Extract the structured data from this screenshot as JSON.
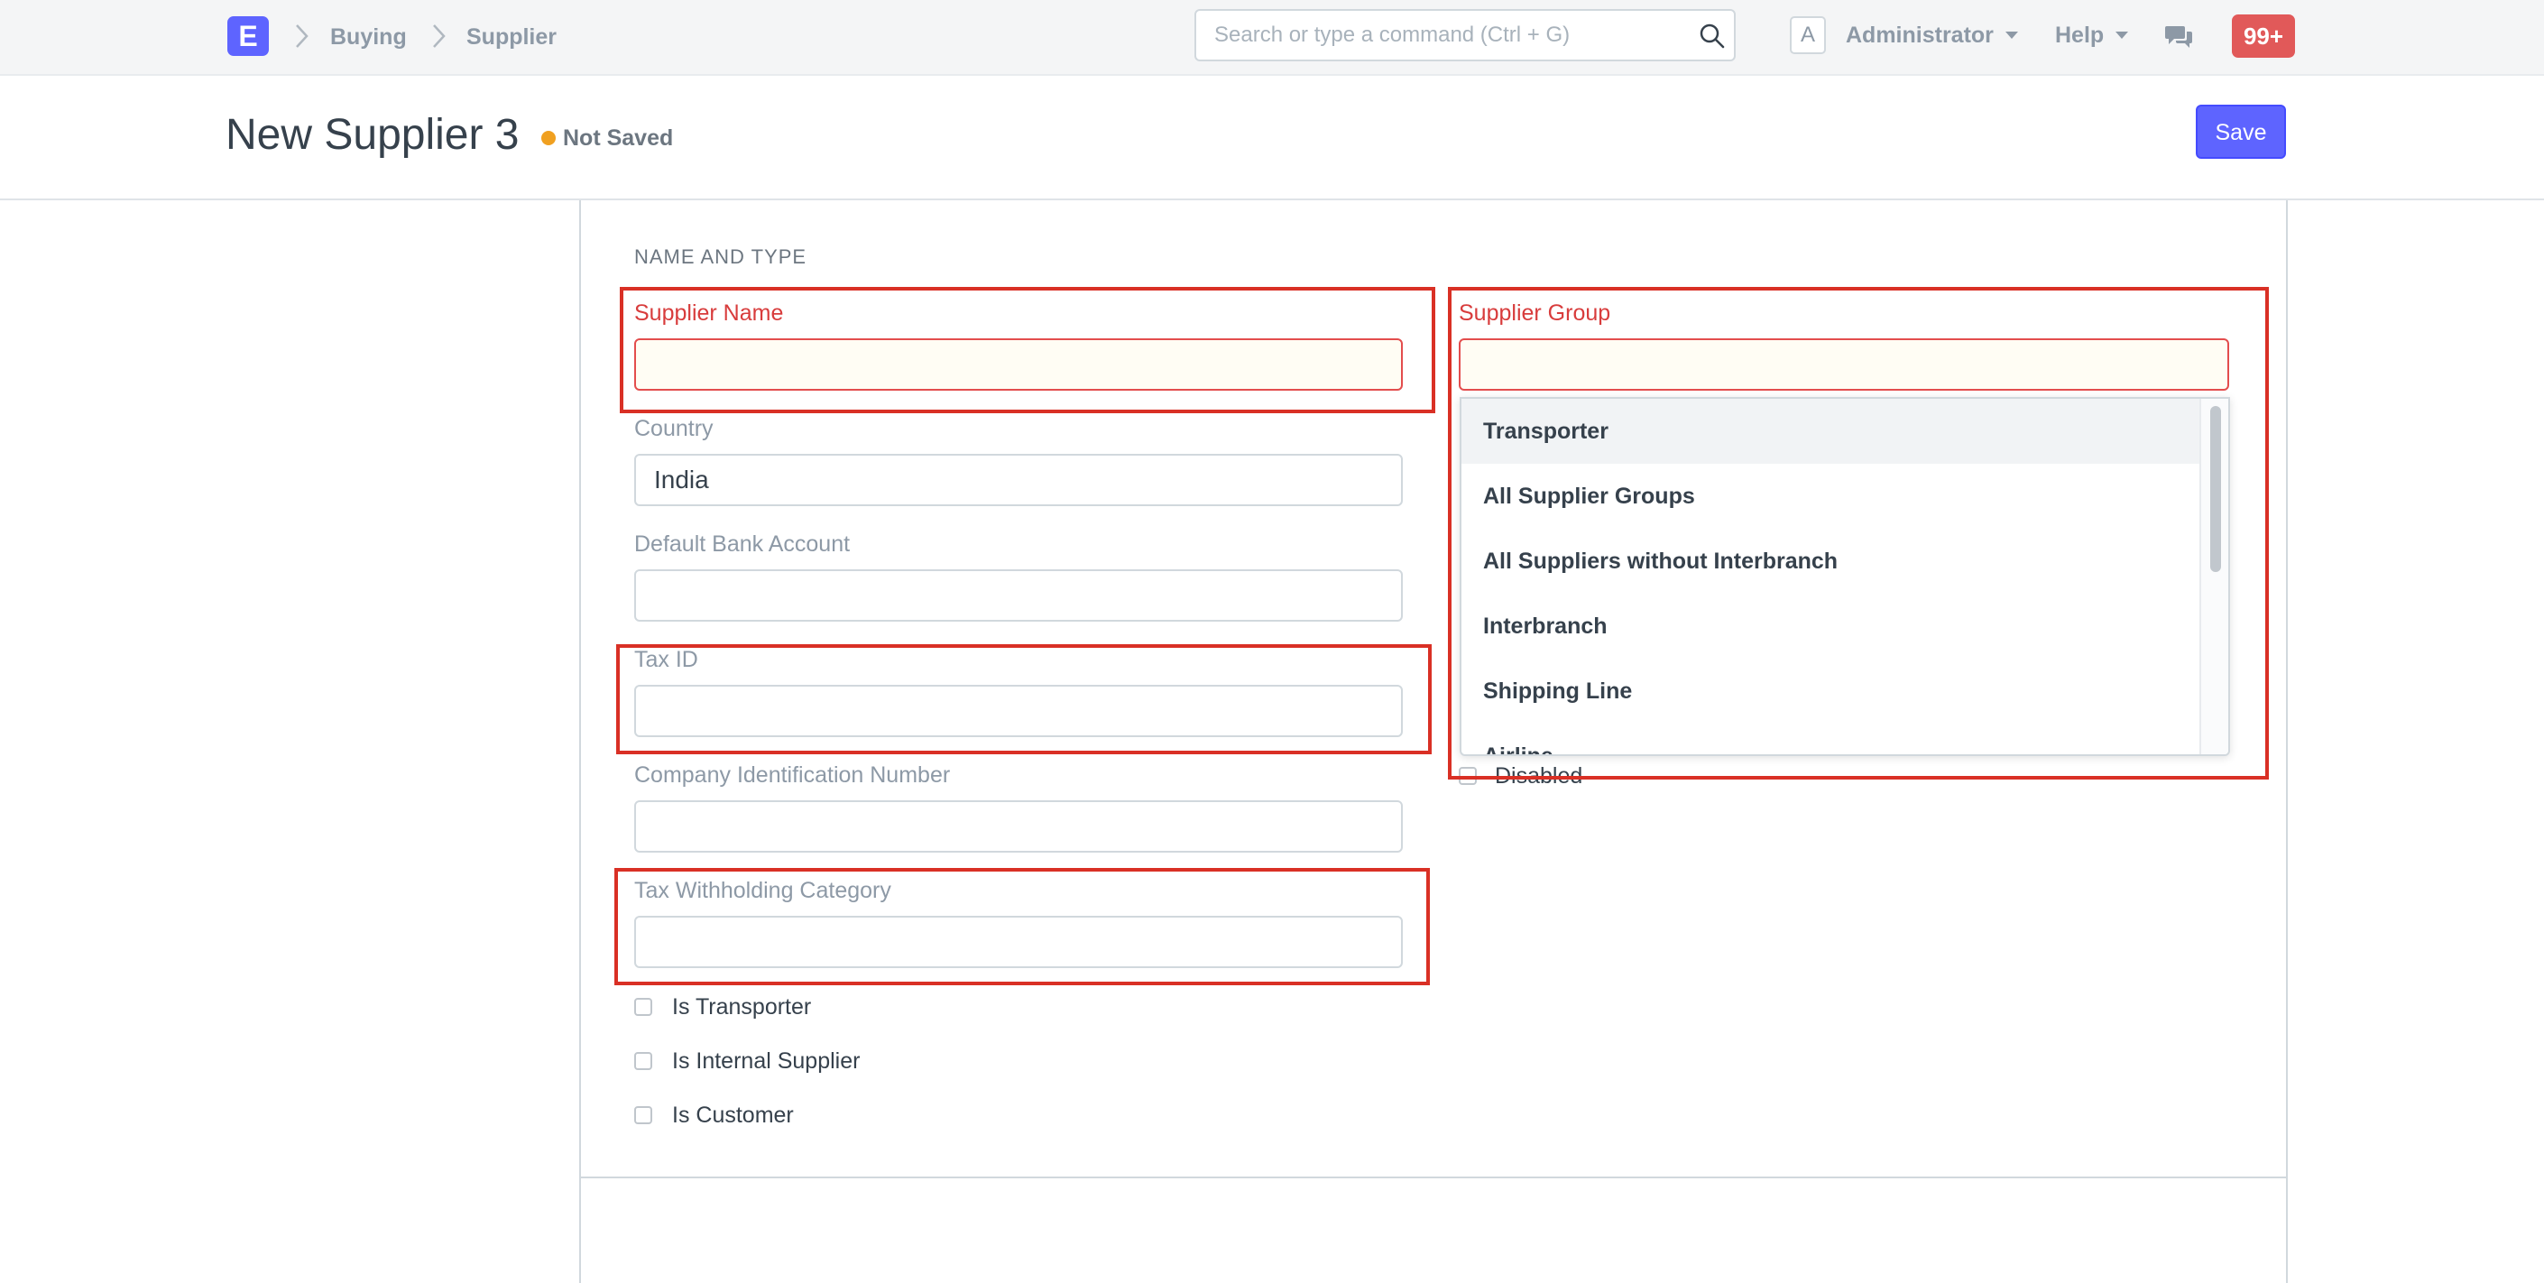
{
  "navbar": {
    "logo_letter": "E",
    "breadcrumbs": [
      "Buying",
      "Supplier"
    ],
    "search_placeholder": "Search or type a command (Ctrl + G)",
    "avatar_letter": "A",
    "user_menu": "Administrator",
    "help_menu": "Help",
    "notifications": "99+"
  },
  "page": {
    "title": "New Supplier 3",
    "status": "Not Saved",
    "save_label": "Save"
  },
  "form": {
    "section_title": "NAME AND TYPE",
    "left_fields": [
      {
        "label": "Supplier Name",
        "value": "",
        "required": true
      },
      {
        "label": "Country",
        "value": "India"
      },
      {
        "label": "Default Bank Account",
        "value": ""
      },
      {
        "label": "Tax ID",
        "value": ""
      },
      {
        "label": "Company Identification Number",
        "value": ""
      },
      {
        "label": "Tax Withholding Category",
        "value": ""
      }
    ],
    "checkboxes": [
      "Is Transporter",
      "Is Internal Supplier",
      "Is Customer"
    ],
    "supplier_group": {
      "label": "Supplier Group",
      "value": "",
      "options": [
        "Transporter",
        "All Supplier Groups",
        "All Suppliers without Interbranch",
        "Interbranch",
        "Shipping Line",
        "Airline"
      ]
    },
    "disabled_label": "Disabled"
  },
  "colors": {
    "primary": "#5e64ff",
    "error": "#d83c3c",
    "highlight": "#d93025",
    "notification": "#e15959",
    "status_dot": "#f0a020"
  }
}
